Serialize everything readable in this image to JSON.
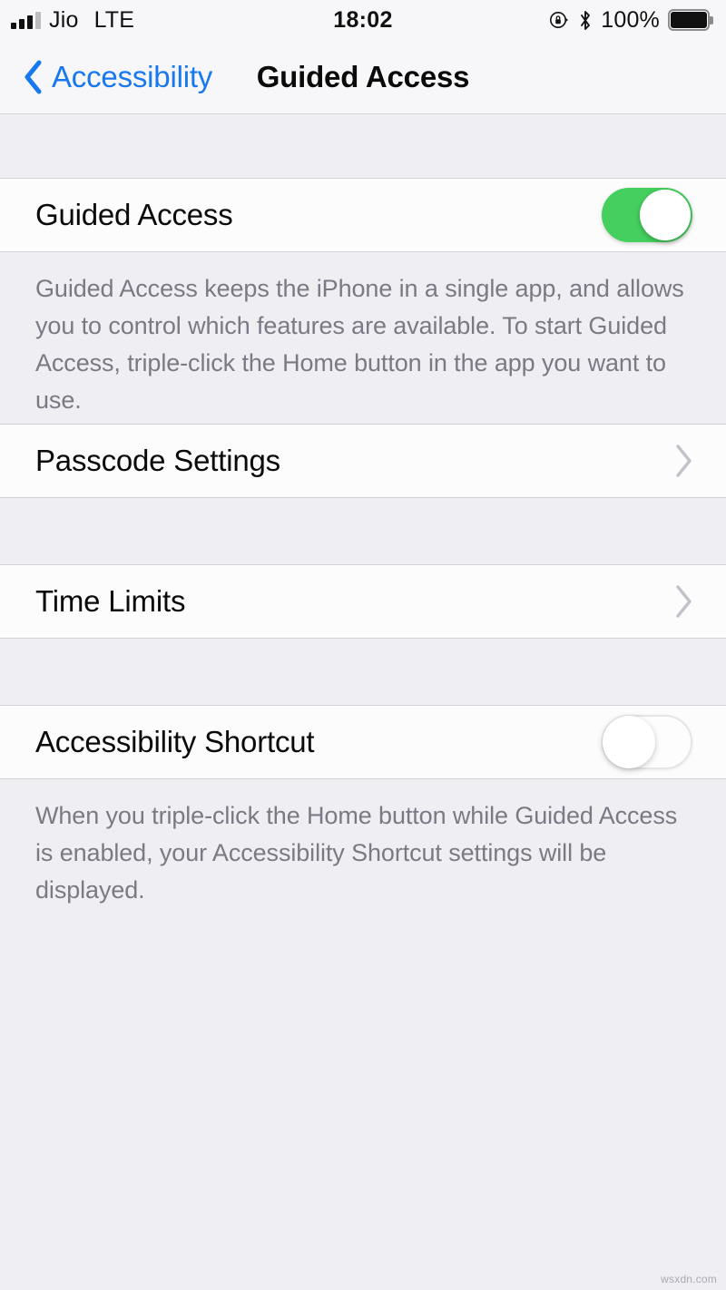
{
  "status_bar": {
    "carrier": "Jio",
    "radio": "LTE",
    "time": "18:02",
    "battery_percent": "100%",
    "icons": {
      "signal": "signal-bars-icon",
      "rotation_lock": "rotation-lock-icon",
      "bluetooth": "bluetooth-icon",
      "battery": "battery-full-icon"
    }
  },
  "nav_bar": {
    "back_label": "Accessibility",
    "title": "Guided Access",
    "back_icon": "chevron-left-icon",
    "accent_color": "#1778ef"
  },
  "sections": [
    {
      "rows": [
        {
          "label": "Guided Access",
          "type": "switch",
          "value": "on",
          "on_color": "#45cf5e"
        }
      ],
      "footer": "Guided Access keeps the iPhone in a single app, and allows you to control which features are available. To start Guided Access, triple-click the Home button in the app you want to use."
    },
    {
      "rows": [
        {
          "label": "Passcode Settings",
          "type": "disclosure",
          "accessory_icon": "chevron-right-icon"
        }
      ],
      "footer": ""
    },
    {
      "rows": [
        {
          "label": "Time Limits",
          "type": "disclosure",
          "accessory_icon": "chevron-right-icon"
        }
      ],
      "footer": ""
    },
    {
      "rows": [
        {
          "label": "Accessibility Shortcut",
          "type": "switch",
          "value": "off"
        }
      ],
      "footer": "When you triple-click the Home button while Guided Access is enabled, your Accessibility Shortcut settings will be displayed."
    }
  ],
  "watermark": "wsxdn.com"
}
